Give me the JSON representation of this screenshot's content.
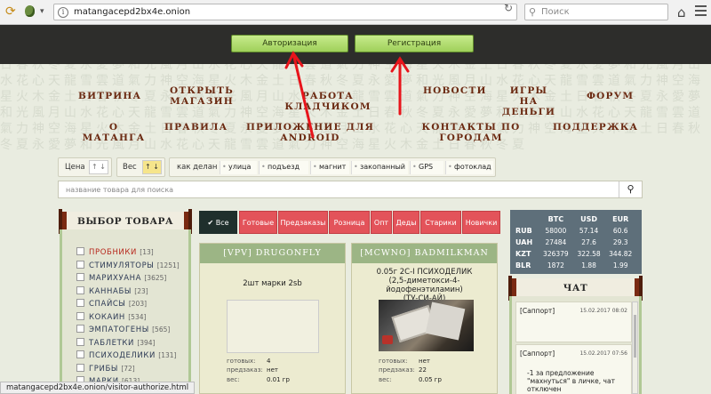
{
  "browser": {
    "url": "matangacepd2bx4e.onion",
    "search_placeholder": "Поиск",
    "status_url": "matangacepd2bx4e.onion/visitor-authorize.html",
    "icons": [
      "tor-icon",
      "onion-icon",
      "info-icon",
      "reload-icon",
      "search-icon",
      "home-icon",
      "menu-icon"
    ]
  },
  "header": {
    "login_label": "Авторизация",
    "register_label": "Регистрация"
  },
  "nav": {
    "row1": [
      "ВИТРИНА",
      "ОТКРЫТЬ",
      "МАГАЗИН",
      "РАБОТА КЛАДЧИКОМ",
      "НОВОСТИ",
      "ИГРЫ НА",
      "ДЕНЬГИ",
      "ФОРУМ"
    ],
    "row2": [
      "О МАТАНГА",
      "ПРАВИЛА",
      "ПРИЛОЖЕНИЕ ДЛЯ ANDROID",
      "КОНТАКТЫ ПО ГОРОДАМ",
      "ПОДДЕРЖКА"
    ]
  },
  "filters": {
    "price_label": "Цена",
    "weight_label": "Вес",
    "sort_symbol": "↑ ↓",
    "weight_sort_symbol": "↑ ↓",
    "delivery_label": "как делан",
    "delivery_options": [
      "улица",
      "подъезд",
      "магнит",
      "закопанный",
      "GPS",
      "фотоклад"
    ],
    "search_placeholder": "название товара для поиска"
  },
  "sidebar": {
    "title": "ВЫБОР ТОВАРА",
    "categories": [
      {
        "name": "ПРОБНИКИ",
        "count": "[13]",
        "highlight": true
      },
      {
        "name": "СТИМУЛЯТОРЫ",
        "count": "[1251]"
      },
      {
        "name": "МАРИХУАНА",
        "count": "[3625]"
      },
      {
        "name": "КАННАБЫ",
        "count": "[23]"
      },
      {
        "name": "СПАЙСЫ",
        "count": "[203]"
      },
      {
        "name": "КОКАИН",
        "count": "[534]"
      },
      {
        "name": "ЭМПАТОГЕНЫ",
        "count": "[565]"
      },
      {
        "name": "ТАБЛЕТКИ",
        "count": "[394]"
      },
      {
        "name": "ПСИХОДЕЛИКИ",
        "count": "[131]"
      },
      {
        "name": "ГРИБЫ",
        "count": "[72]"
      },
      {
        "name": "МАРКИ",
        "count": "[613]"
      }
    ]
  },
  "tabs": {
    "check_symbol": "✔",
    "items": [
      "Все",
      "Готовые",
      "Предзаказы",
      "Розница",
      "Опт",
      "Деды",
      "Старики",
      "Новички"
    ]
  },
  "products": [
    {
      "shop": "[VPV] DRUGONFLY",
      "title": "2шт марки 2sb",
      "has_photo": false,
      "ready_label": "готовых:",
      "ready": "4",
      "preorder_label": "предзаказ:",
      "preorder": "нет",
      "weight_label": "вес:",
      "weight": "0.01 гр"
    },
    {
      "shop": "[MCWNO] BADMILKMAN",
      "title_lines": [
        "0.05г 2C-I ПСИХОДЕЛИК",
        "(2,5-диметокси-4-йодофенэтиламин)",
        "(ТУ-СИ-АЙ)"
      ],
      "has_photo": true,
      "ready_label": "готовых:",
      "ready": "нет",
      "preorder_label": "предзаказ:",
      "preorder": "22",
      "weight_label": "вес:",
      "weight": "0.05 гр"
    }
  ],
  "rates": {
    "headers": [
      "BTC",
      "USD",
      "EUR"
    ],
    "rows": [
      {
        "cur": "RUB",
        "vals": [
          "58000",
          "57.14",
          "60.6"
        ]
      },
      {
        "cur": "UAH",
        "vals": [
          "27484",
          "27.6",
          "29.3"
        ]
      },
      {
        "cur": "KZT",
        "vals": [
          "326379",
          "322.58",
          "344.82"
        ]
      },
      {
        "cur": "BLR",
        "vals": [
          "1872",
          "1.88",
          "1.99"
        ]
      }
    ]
  },
  "chat": {
    "title": "ЧАТ",
    "messages": [
      {
        "who": "[Саппорт]",
        "when": "15.02.2017 08:02",
        "text": ""
      },
      {
        "who": "[Саппорт]",
        "when": "15.02.2017 07:56",
        "text": "-1 за предложение \"махнуться\" в личке, чат отключен"
      }
    ]
  },
  "colors": {
    "topbar": "#2d2d2b",
    "nav_text": "#6b2a12",
    "tab_red": "#e3535a",
    "tab_active": "#1f2f2c",
    "card_header": "#9cb585",
    "rates_bg": "#5e6f7a",
    "arrow": "#e8141b"
  }
}
